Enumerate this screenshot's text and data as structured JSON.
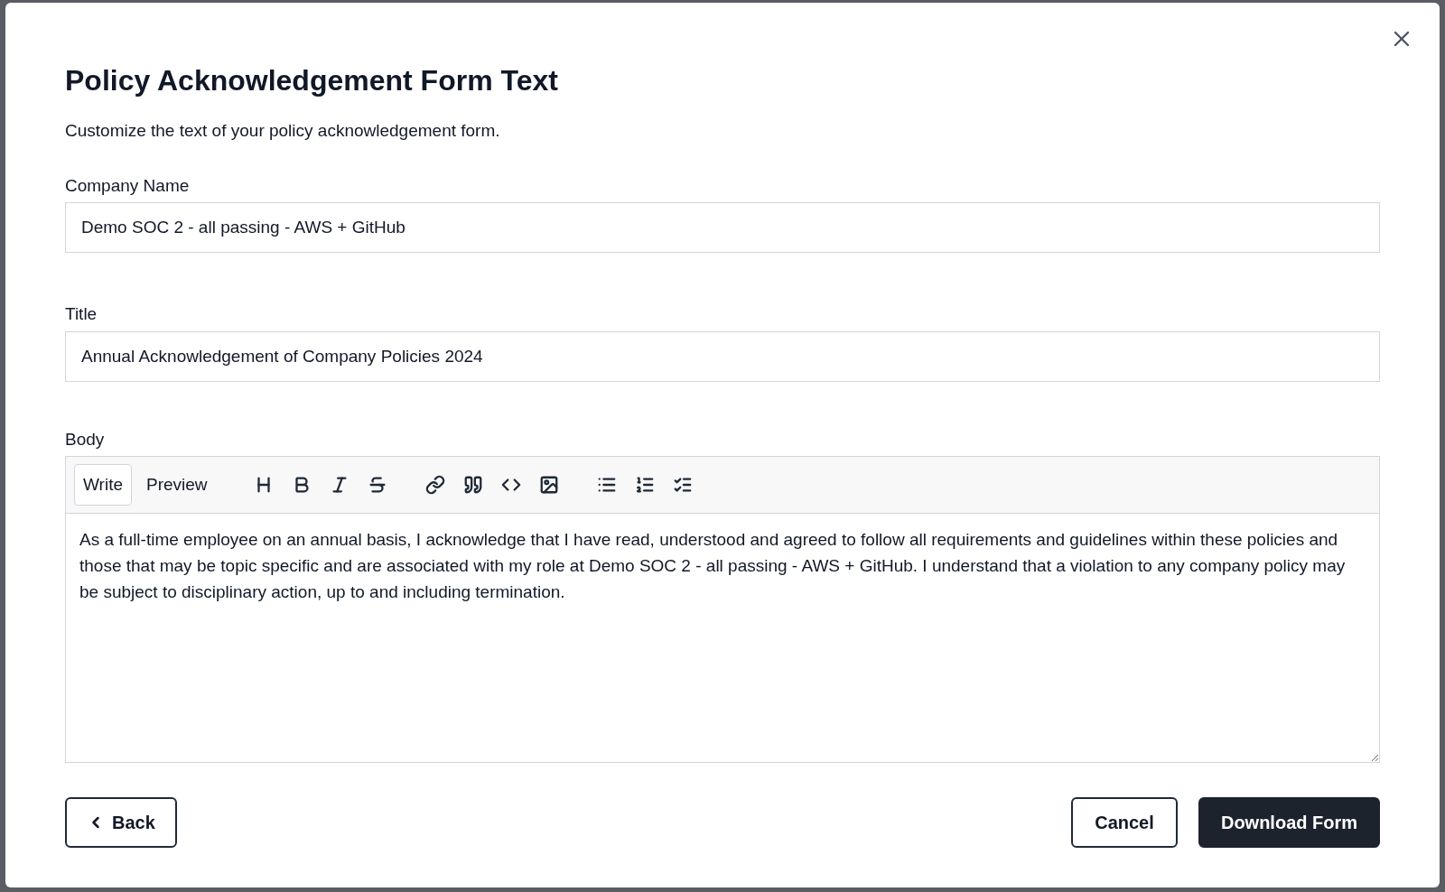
{
  "dialog": {
    "title": "Policy Acknowledgement Form Text",
    "description": "Customize the text of your policy acknowledgement form."
  },
  "fields": [
    {
      "label": "Company Name",
      "value": "Demo SOC 2 - all passing - AWS + GitHub"
    },
    {
      "label": "Title",
      "value": "Annual Acknowledgement of Company Policies 2024"
    }
  ],
  "body": {
    "label": "Body",
    "tabs": [
      {
        "label": "Write",
        "selected": true
      },
      {
        "label": "Preview",
        "selected": false
      }
    ],
    "toolbar": [
      {
        "kind": "heading"
      },
      {
        "kind": "bold"
      },
      {
        "kind": "italic"
      },
      {
        "kind": "strike"
      },
      {
        "kind": "gap"
      },
      {
        "kind": "link"
      },
      {
        "kind": "quote"
      },
      {
        "kind": "code"
      },
      {
        "kind": "image"
      },
      {
        "kind": "gap"
      },
      {
        "kind": "bullets"
      },
      {
        "kind": "numbers"
      },
      {
        "kind": "tasks"
      }
    ],
    "value": "As a full-time employee on an annual basis, I acknowledge that I have read, understood and agreed to follow all requirements and guidelines within these policies and those that may be topic specific and are associated with my role at Demo SOC 2 - all passing - AWS + GitHub. I understand that a violation to any company policy may be subject to disciplinary action, up to and including termination."
  },
  "buttons": {
    "back": "Back",
    "cancel": "Cancel",
    "download": "Download Form"
  }
}
